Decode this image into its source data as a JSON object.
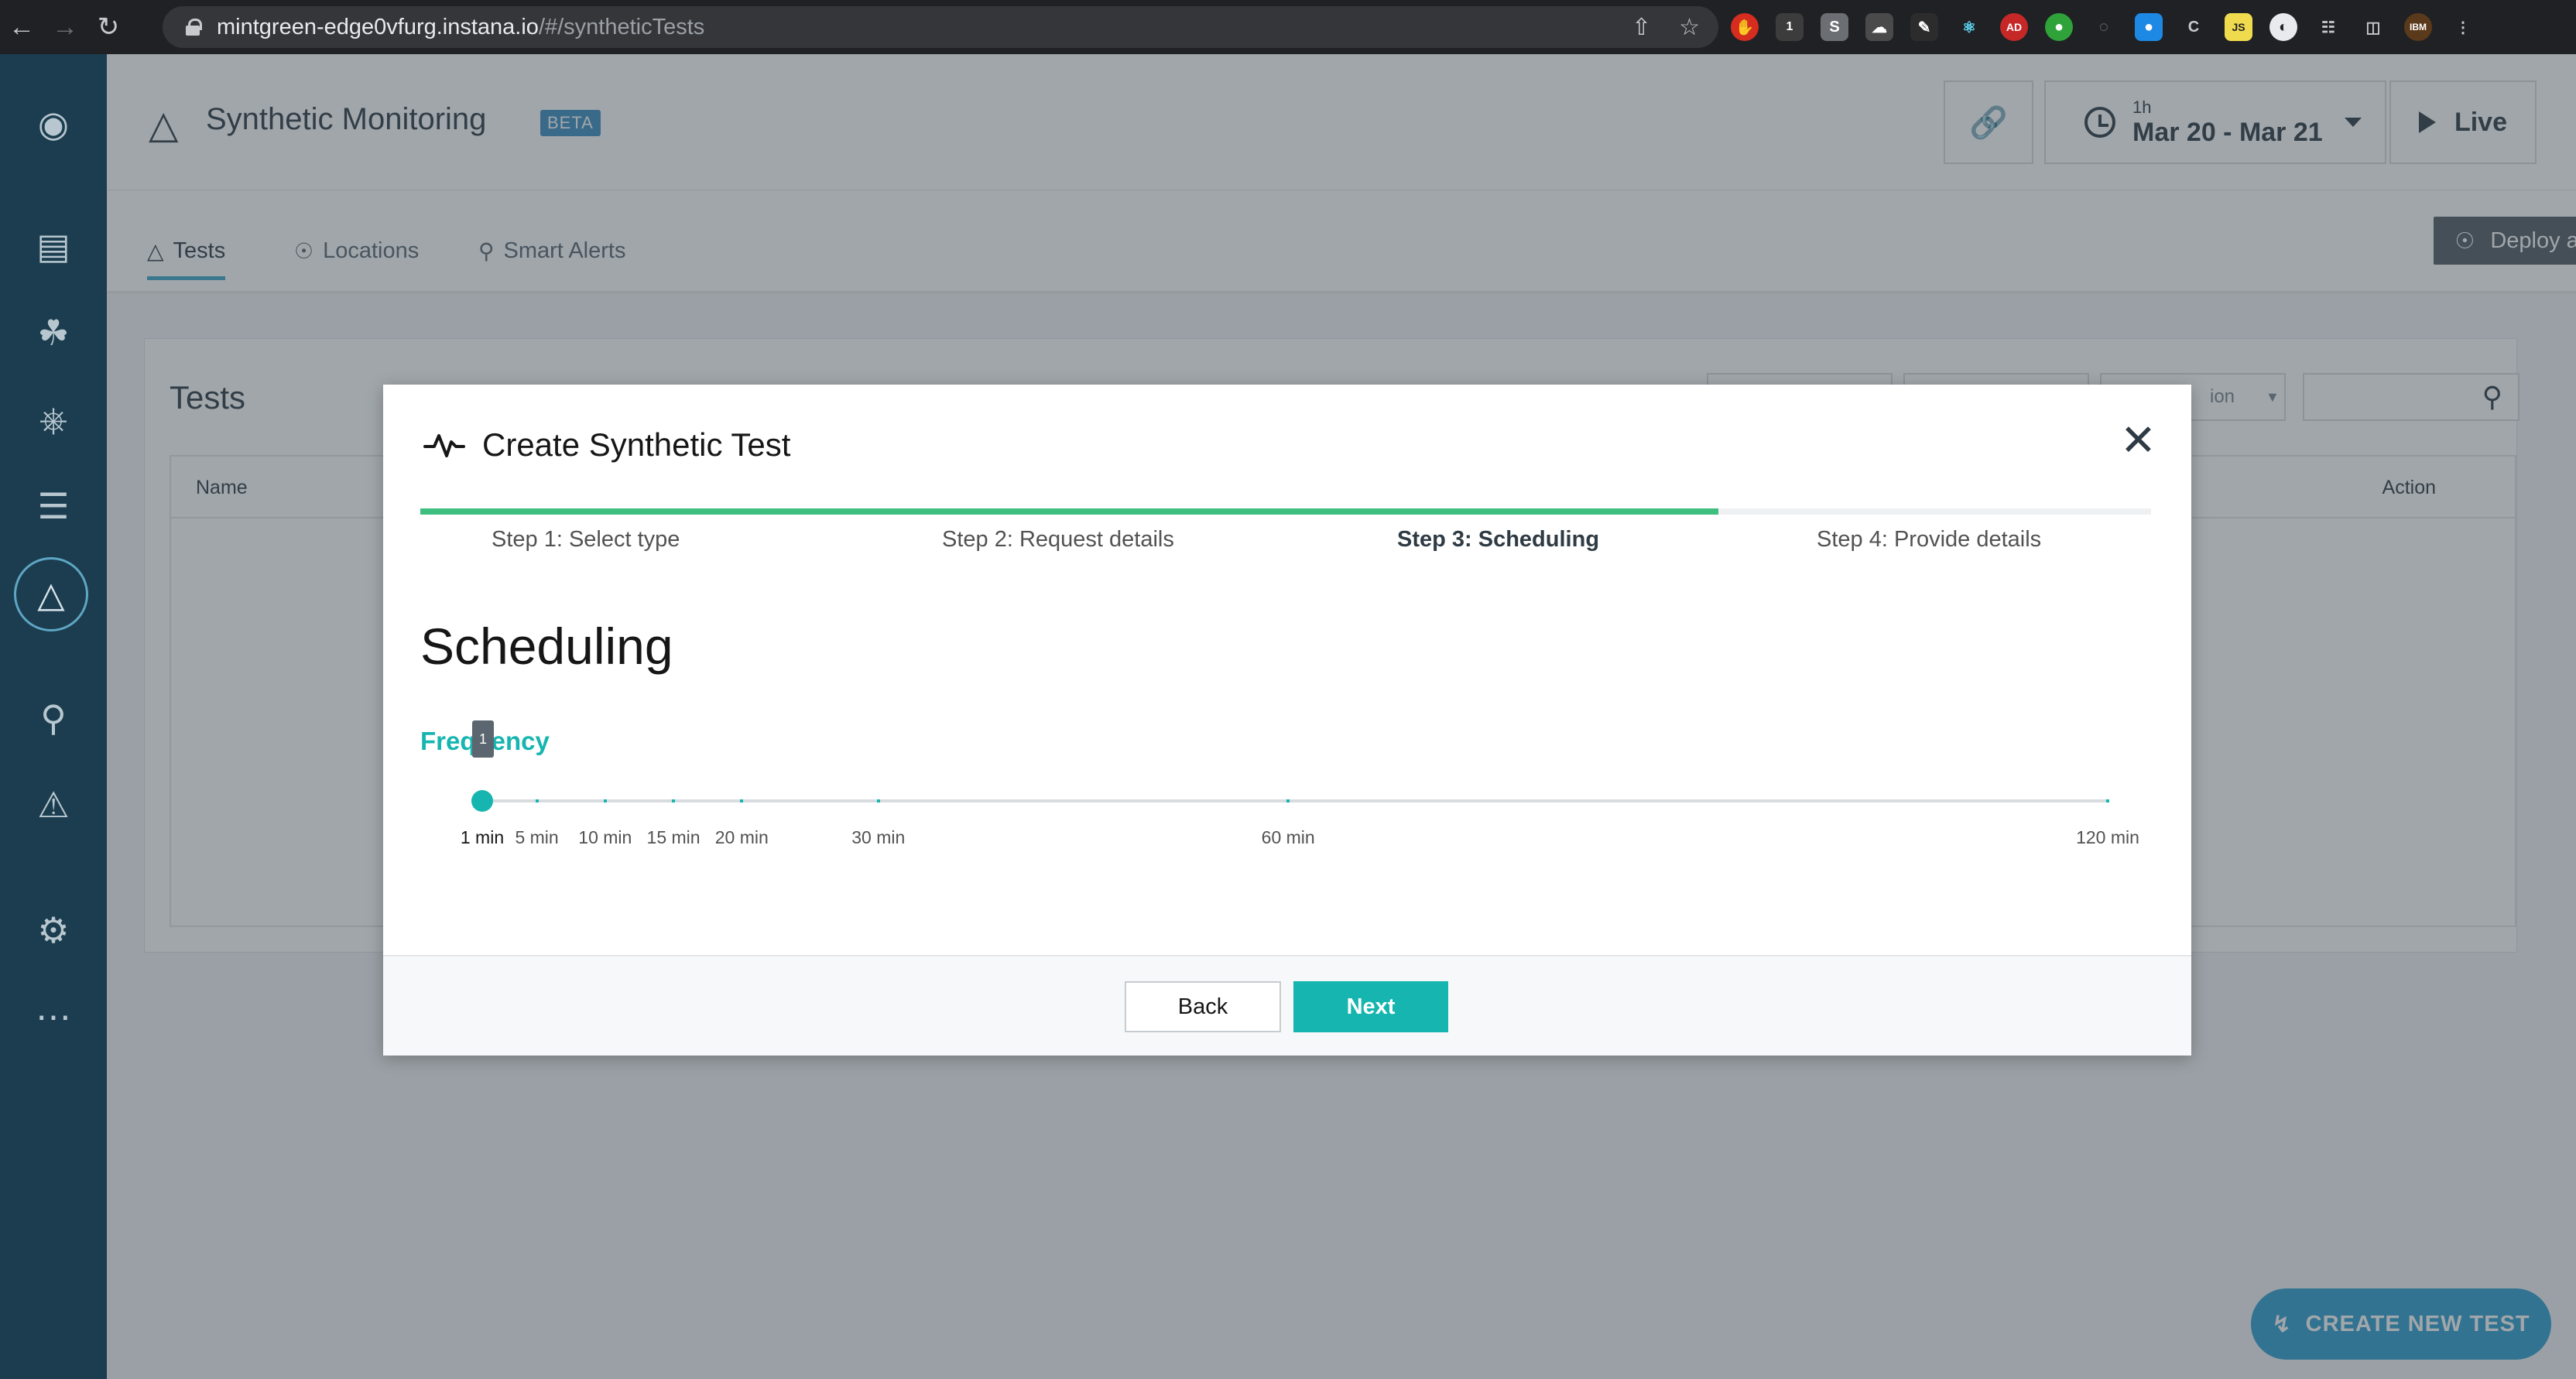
{
  "browser": {
    "url_host": "mintgreen-edge0vfurg.instana.io",
    "url_path": "/#/syntheticTests",
    "extension_badge": "1"
  },
  "leftnav": {
    "items": [
      "app-icon",
      "websites-icon",
      "applications-icon",
      "kubernetes-icon",
      "infrastructure-icon",
      "synthetic-icon",
      "analytics-icon",
      "events-icon",
      "settings-icon",
      "more-icon"
    ]
  },
  "header": {
    "title": "Synthetic Monitoring",
    "badge": "BETA",
    "time_window": "1h",
    "time_range": "Mar 20 - Mar 21",
    "live_label": "Live"
  },
  "tabs": [
    {
      "label": "Tests",
      "active": true
    },
    {
      "label": "Locations",
      "active": false
    },
    {
      "label": "Smart Alerts",
      "active": false
    }
  ],
  "deploy_button": "Deploy a PoP",
  "page": {
    "card_title": "Tests",
    "filter_partial": "ion",
    "table_headers": {
      "name": "Name",
      "action": "Action"
    }
  },
  "create_new_button": "CREATE NEW TEST",
  "modal": {
    "title": "Create Synthetic Test",
    "steps": [
      {
        "label": "Step 1: Select type",
        "current": false
      },
      {
        "label": "Step 2: Request details",
        "current": false
      },
      {
        "label": "Step 3: Scheduling",
        "current": true
      },
      {
        "label": "Step 4: Provide details",
        "current": false
      }
    ],
    "progress_fraction": 0.75,
    "section_title": "Scheduling",
    "frequency_label": "Frequency",
    "frequency_tooltip": "1",
    "slider": {
      "min": 1,
      "max": 120,
      "value": 1,
      "marks": [
        "1 min",
        "5 min",
        "10 min",
        "15 min",
        "20 min",
        "30 min",
        "60 min",
        "120 min"
      ],
      "mark_values": [
        1,
        5,
        10,
        15,
        20,
        30,
        60,
        120
      ]
    },
    "back_label": "Back",
    "next_label": "Next"
  },
  "colors": {
    "accent": "#16b5b0",
    "progress": "#3fbf7f",
    "nav_bg": "#1b3d4f",
    "create_btn": "#2f9fd0"
  }
}
